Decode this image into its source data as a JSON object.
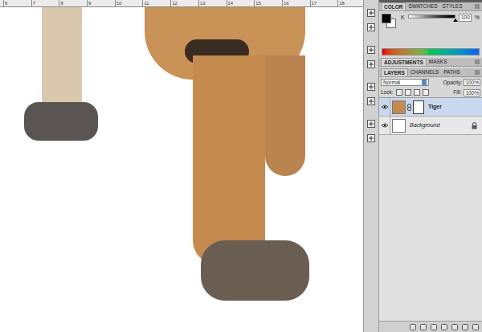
{
  "ruler": {
    "ticks": [
      "6",
      "7",
      "8",
      "9",
      "10",
      "11",
      "12",
      "13",
      "14",
      "15",
      "16",
      "17",
      "18"
    ]
  },
  "color_panel": {
    "tabs": [
      {
        "label": "COLOR",
        "selected": true
      },
      {
        "label": "SWATCHES",
        "selected": false
      },
      {
        "label": "STYLES",
        "selected": false
      }
    ],
    "channel": {
      "label": "K",
      "level": 1.0,
      "value": "100",
      "unit": "%"
    }
  },
  "adjustments_panel": {
    "tabs": [
      {
        "label": "ADJUSTMENTS",
        "selected": true
      },
      {
        "label": "MASKS",
        "selected": false
      }
    ]
  },
  "layers_panel": {
    "tabs": [
      {
        "label": "LAYERS",
        "selected": true
      },
      {
        "label": "CHANNELS",
        "selected": false
      },
      {
        "label": "PATHS",
        "selected": false
      }
    ],
    "blend_mode": "Normal",
    "opacity_label": "Opacity:",
    "opacity": "100%",
    "lock_label": "Lock:",
    "fill_label": "Fill:",
    "fill": "100%",
    "layers": [
      {
        "name": "Tiger",
        "selected": true,
        "visible": true,
        "locked": false,
        "has_mask": true
      },
      {
        "name": "Background",
        "selected": false,
        "visible": true,
        "locked": true,
        "has_mask": false
      }
    ]
  }
}
